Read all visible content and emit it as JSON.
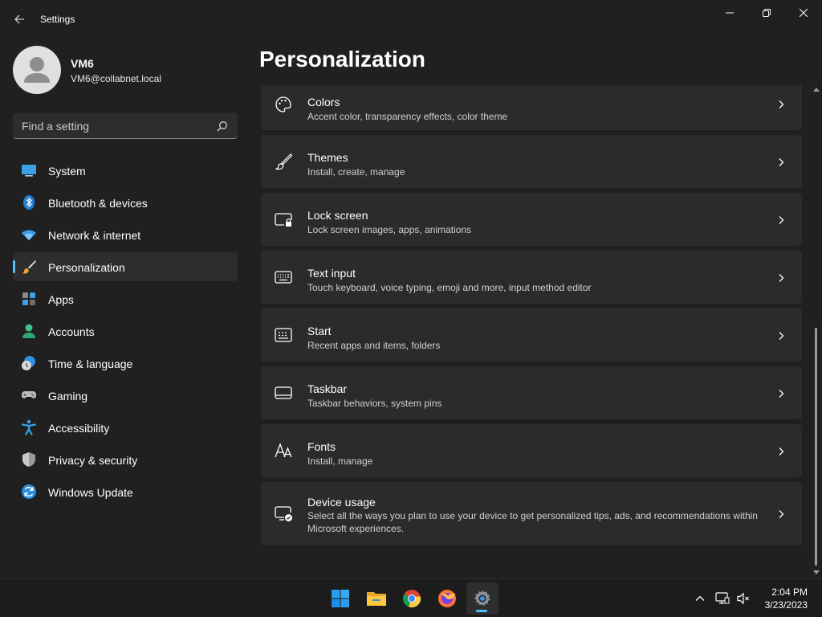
{
  "window": {
    "title": "Settings"
  },
  "profile": {
    "name": "VM6",
    "email": "VM6@collabnet.local"
  },
  "search": {
    "placeholder": "Find a setting"
  },
  "sidebar": {
    "items": [
      {
        "label": "System",
        "icon": "monitor-icon"
      },
      {
        "label": "Bluetooth & devices",
        "icon": "bluetooth-icon"
      },
      {
        "label": "Network & internet",
        "icon": "wifi-icon"
      },
      {
        "label": "Personalization",
        "icon": "brush-icon",
        "selected": true
      },
      {
        "label": "Apps",
        "icon": "apps-icon"
      },
      {
        "label": "Accounts",
        "icon": "person-icon"
      },
      {
        "label": "Time & language",
        "icon": "clock-globe-icon"
      },
      {
        "label": "Gaming",
        "icon": "gamepad-icon"
      },
      {
        "label": "Accessibility",
        "icon": "accessibility-icon"
      },
      {
        "label": "Privacy & security",
        "icon": "shield-icon"
      },
      {
        "label": "Windows Update",
        "icon": "update-icon"
      }
    ]
  },
  "main": {
    "title": "Personalization",
    "cards": [
      {
        "title": "Colors",
        "desc": "Accent color, transparency effects, color theme",
        "icon": "palette-icon"
      },
      {
        "title": "Themes",
        "desc": "Install, create, manage",
        "icon": "brush-icon"
      },
      {
        "title": "Lock screen",
        "desc": "Lock screen images, apps, animations",
        "icon": "lock-screen-icon"
      },
      {
        "title": "Text input",
        "desc": "Touch keyboard, voice typing, emoji and more, input method editor",
        "icon": "keyboard-icon"
      },
      {
        "title": "Start",
        "desc": "Recent apps and items, folders",
        "icon": "start-icon"
      },
      {
        "title": "Taskbar",
        "desc": "Taskbar behaviors, system pins",
        "icon": "taskbar-icon"
      },
      {
        "title": "Fonts",
        "desc": "Install, manage",
        "icon": "fonts-icon"
      },
      {
        "title": "Device usage",
        "desc": "Select all the ways you plan to use your device to get personalized tips, ads, and recommendations within Microsoft experiences.",
        "icon": "device-usage-icon"
      }
    ]
  },
  "taskbar": {
    "apps": [
      "windows-start-icon",
      "file-explorer-icon",
      "chrome-icon",
      "firefox-icon",
      "settings-icon"
    ],
    "clock": {
      "time": "2:04 PM",
      "date": "3/23/2023"
    }
  },
  "colors": {
    "accent": "#4cc2ff",
    "background": "#202020",
    "card": "#2b2b2b"
  }
}
